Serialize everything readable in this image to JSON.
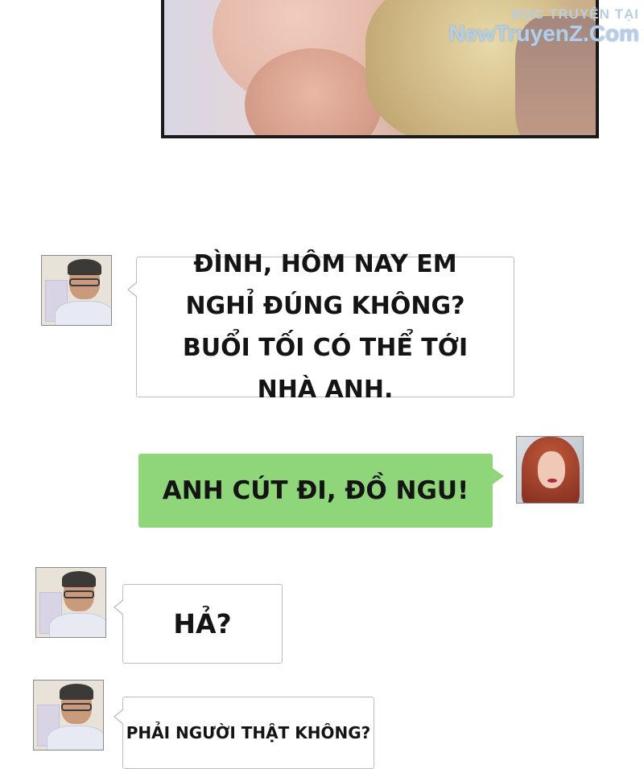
{
  "watermark": {
    "line1": "ĐỌC TRUYỆN TẠI",
    "line2": "NewTruyenZ.Com"
  },
  "messages": [
    {
      "sender": "man",
      "side": "left",
      "text": "ĐÌNH, HÔM NAY EM NGHỈ ĐÚNG KHÔNG? BUỔI TỐI CÓ THỂ TỚI NHÀ ANH."
    },
    {
      "sender": "woman",
      "side": "right",
      "text": "ANH CÚT ĐI, ĐỒ NGU!"
    },
    {
      "sender": "man",
      "side": "left",
      "text": "HẢ?"
    },
    {
      "sender": "man",
      "side": "left",
      "text": "PHẢI NGƯỜI THẬT KHÔNG?"
    }
  ],
  "colors": {
    "outgoing_bubble": "#8fd67a",
    "incoming_bubble": "#ffffff",
    "panel_border": "#1a1a1a"
  }
}
